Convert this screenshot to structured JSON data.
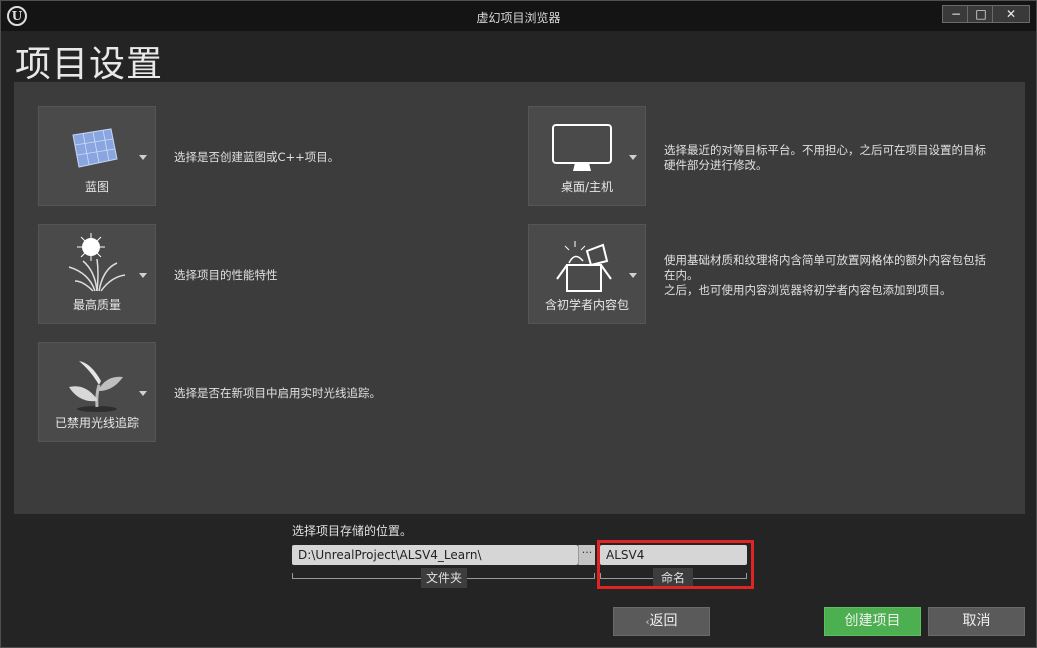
{
  "window": {
    "title": "虚幻项目浏览器",
    "controls": {
      "minimize": "−",
      "maximize": "□",
      "close": "✕"
    }
  },
  "page": {
    "title": "项目设置"
  },
  "settings": [
    {
      "tile_label": "蓝图",
      "description": "选择是否创建蓝图或C++项目。",
      "icon": "blueprint-icon"
    },
    {
      "tile_label": "最高质量",
      "description": "选择项目的性能特性",
      "icon": "quality-icon"
    },
    {
      "tile_label": "已禁用光线追踪",
      "description": "选择是否在新项目中启用实时光线追踪。",
      "icon": "raytracing-icon"
    },
    {
      "tile_label": "桌面/主机",
      "description_line1": "选择最近的对等目标平台。不用担心，之后可在项目设置的目标",
      "description_line2": "硬件部分进行修改。",
      "icon": "monitor-icon"
    },
    {
      "tile_label": "含初学者内容包",
      "description_line1": "使用基础材质和纹理将内含简单可放置网格体的额外内容包包括",
      "description_line2": "在内。",
      "description_line3": "之后，也可使用内容浏览器将初学者内容包添加到项目。",
      "icon": "starter-content-icon"
    }
  ],
  "location": {
    "label": "选择项目存储的位置。",
    "folder_value": "D:\\UnrealProject\\ALSV4_Learn\\",
    "browse": "···",
    "folder_caption": "文件夹",
    "name_value": "ALSV4",
    "name_caption": "命名"
  },
  "buttons": {
    "back": "返回",
    "create": "创建项目",
    "cancel": "取消"
  },
  "colors": {
    "create_button": "#4caf50",
    "highlight_box": "#e02424"
  }
}
